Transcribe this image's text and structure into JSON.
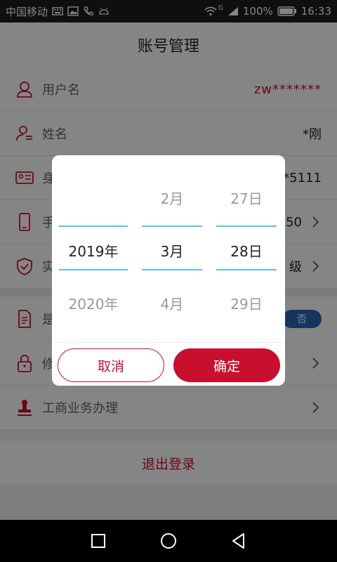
{
  "status_bar": {
    "carrier": "中国移动",
    "network_type": "G",
    "battery_percent": "100%",
    "time": "16:33"
  },
  "header": {
    "title": "账号管理"
  },
  "rows": [
    {
      "label": "用户名",
      "value": "zw*******",
      "icon": "user-icon"
    },
    {
      "label": "姓名",
      "value": "*刚",
      "icon": "user-list-icon"
    },
    {
      "label": "身",
      "value": "*5111",
      "icon": "id-card-icon"
    },
    {
      "label": "手",
      "value": "50",
      "icon": "phone-icon"
    },
    {
      "label": "实",
      "value": "级",
      "icon": "shield-icon"
    },
    {
      "label": "是",
      "value": "否",
      "icon": "document-icon"
    },
    {
      "label": "修",
      "value": "",
      "icon": "lock-icon"
    },
    {
      "label": "工商业务办理",
      "value": "",
      "icon": "stamp-icon"
    }
  ],
  "logout_label": "退出登录",
  "picker": {
    "year": {
      "above": "",
      "selected": "2019年",
      "below": "2020年"
    },
    "month": {
      "above": "2月",
      "selected": "3月",
      "below": "4月"
    },
    "day": {
      "above": "27日",
      "selected": "28日",
      "below": "29日"
    },
    "cancel_label": "取消",
    "confirm_label": "确定"
  },
  "colors": {
    "accent": "#c8102e",
    "picker_line": "#5cc0ea",
    "toggle": "#2a66b8"
  }
}
